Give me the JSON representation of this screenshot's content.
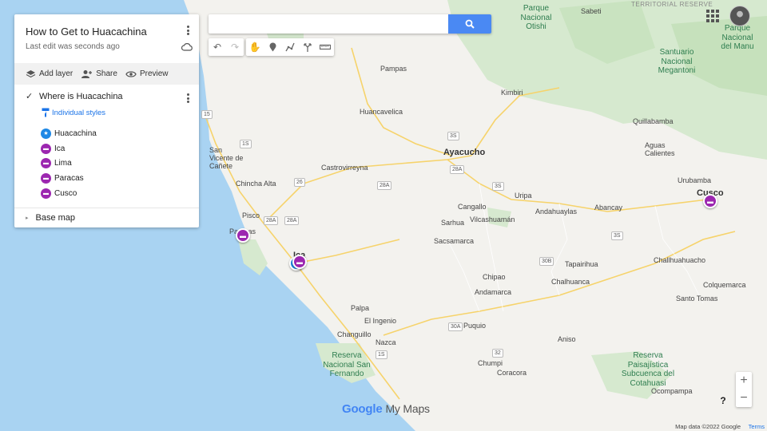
{
  "panel": {
    "title": "How to Get to Huacachina",
    "subtitle": "Last edit was seconds ago",
    "actions": {
      "add_layer": "Add layer",
      "share": "Share",
      "preview": "Preview"
    },
    "layer": {
      "name": "Where is Huacachina",
      "styles_link": "Individual styles",
      "features": [
        {
          "label": "Huacachina",
          "icon": "star-icon",
          "color": "#1e88e5"
        },
        {
          "label": "Ica",
          "icon": "bed-icon",
          "color": "#9c27b0"
        },
        {
          "label": "Lima",
          "icon": "bed-icon",
          "color": "#9c27b0"
        },
        {
          "label": "Paracas",
          "icon": "bed-icon",
          "color": "#9c27b0"
        },
        {
          "label": "Cusco",
          "icon": "bed-icon",
          "color": "#9c27b0"
        }
      ]
    },
    "base_map": "Base map"
  },
  "search": {
    "value": "",
    "placeholder": ""
  },
  "map": {
    "cities": {
      "ayacucho": "Ayacucho",
      "cusco": "Cusco",
      "ica": "Ica"
    },
    "places": {
      "pampas": "Pampas",
      "kimbiri": "Kimbiri",
      "huancavelica": "Huancavelica",
      "castrovirreyna": "Castrovirreyna",
      "san_vicente": "San Vicente de Cañete",
      "chincha": "Chincha Alta",
      "pisco": "Pisco",
      "paracas": "Paracas",
      "cangallo": "Cangallo",
      "uripa": "Uripa",
      "andahuaylas": "Andahuaylas",
      "abancay": "Abancay",
      "sarhua": "Sarhua",
      "vilcashuaman": "Vilcashuamán",
      "sacsamarca": "Sacsamarca",
      "tapairihua": "Tapairihua",
      "chalhuanca": "Chalhuanca",
      "challhuahuacho": "Challhuahuacho",
      "chipao": "Chipao",
      "andamarca": "Andamarca",
      "palpa": "Palpa",
      "el_ingenio": "El Ingenio",
      "changuillo": "Changuillo",
      "puquio": "Puquio",
      "nazca": "Nazca",
      "aniso": "Aniso",
      "chumpi": "Chumpi",
      "coracora": "Coracora",
      "ocompampa": "Ocompampa",
      "colquemarca": "Colquemarca",
      "santo_tomas": "Santo Tomas",
      "quillabamba": "Quillabamba",
      "aguas_calientes": "Aguas Calientes",
      "urubamba": "Urubamba",
      "sabeti": "Sabeti"
    },
    "parks": {
      "otishi": "Parque Nacional Otishi",
      "manu": "Parque Nacional del Manu",
      "megantoni": "Santuario Nacional Megantoni",
      "san_fernando": "Reserva Nacional San Fernando",
      "pampa_galeras": "Reserva Paisajística Subcuenca del Cotahuasi",
      "territorial": "TERRITORIAL RESERVE"
    },
    "routes": [
      "15",
      "1S",
      "26",
      "28A",
      "28A",
      "28A",
      "3S",
      "3S",
      "3S",
      "30B",
      "30A",
      "32",
      "1S",
      "28A"
    ],
    "markers": [
      {
        "name": "huacachina",
        "color": "#1e88e5",
        "icon": "star-icon"
      },
      {
        "name": "ica",
        "color": "#9c27b0",
        "icon": "bed-icon"
      },
      {
        "name": "paracas",
        "color": "#9c27b0",
        "icon": "bed-icon"
      },
      {
        "name": "cusco",
        "color": "#9c27b0",
        "icon": "bed-icon"
      }
    ]
  },
  "footer": {
    "logo_google": "Google",
    "logo_mymaps": "My Maps",
    "attribution": "Map data ©2022 Google",
    "terms": "Terms"
  },
  "controls": {
    "zoom_in": "+",
    "zoom_out": "−",
    "help": "?"
  },
  "colors": {
    "water": "#a9d3f2",
    "land": "#f4f3ef",
    "green": "#cfe8c8",
    "accent": "#4a89f3"
  }
}
